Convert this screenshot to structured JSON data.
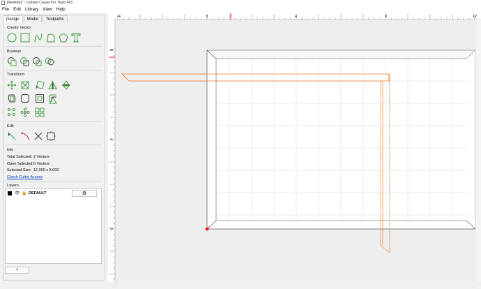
{
  "window": {
    "title": "[NewFile]* - Carbide Create Pro, Build 843"
  },
  "menu": [
    {
      "label": "File"
    },
    {
      "label": "Edit"
    },
    {
      "label": "Library"
    },
    {
      "label": "View"
    },
    {
      "label": "Help"
    }
  ],
  "tabs": [
    {
      "label": "Design",
      "active": true
    },
    {
      "label": "Model",
      "active": false
    },
    {
      "label": "Toolpaths",
      "active": false
    }
  ],
  "sections": {
    "create_vector": "Create Vector",
    "boolean": "Boolean",
    "transform": "Transform",
    "edit": "Edit",
    "info": "Info",
    "layers": "Layers"
  },
  "create_vector_tools": [
    "circle-icon",
    "rectangle-icon",
    "curve-icon",
    "polyline-icon",
    "polygon-icon",
    "text-icon"
  ],
  "boolean_tools": [
    "union-icon",
    "difference-icon",
    "intersect-icon",
    "weld-icon"
  ],
  "transform_tools": [
    "move-icon",
    "scale-icon",
    "rotate-icon",
    "mirror-icon",
    "flip-icon",
    "offset-icon",
    "rounded-rect-icon",
    "inset-icon",
    "fillet-icon",
    "triangle-icon",
    "circular-array-icon",
    "radial-array-icon",
    "grid-array-icon"
  ],
  "edit_tools": [
    "node-edit-icon",
    "curve-edit-icon",
    "trim-icon",
    "bounding-box-icon"
  ],
  "info": {
    "total_selected_label": "Total Selected:",
    "total_selected_value": "2 Vectors",
    "open_selected_label": "Open Selected:",
    "open_selected_value": "0 Vectors",
    "selected_size_label": "Selected Size:",
    "selected_size_value": "12.000 x 8.000",
    "check_cutter_link": "Check Cutter Access"
  },
  "layers": {
    "items": [
      {
        "name": "DEFAULT",
        "color": "#000000"
      }
    ],
    "settings_icon": "gear-icon",
    "add_label": "+"
  },
  "canvas": {
    "ruler_top_labels": [
      "-4",
      "0",
      "4",
      "8",
      "12"
    ],
    "ruler_left_labels": [
      "8",
      "4",
      "0"
    ],
    "accent": "#e8741c",
    "cursor_marker": "#e02020"
  }
}
